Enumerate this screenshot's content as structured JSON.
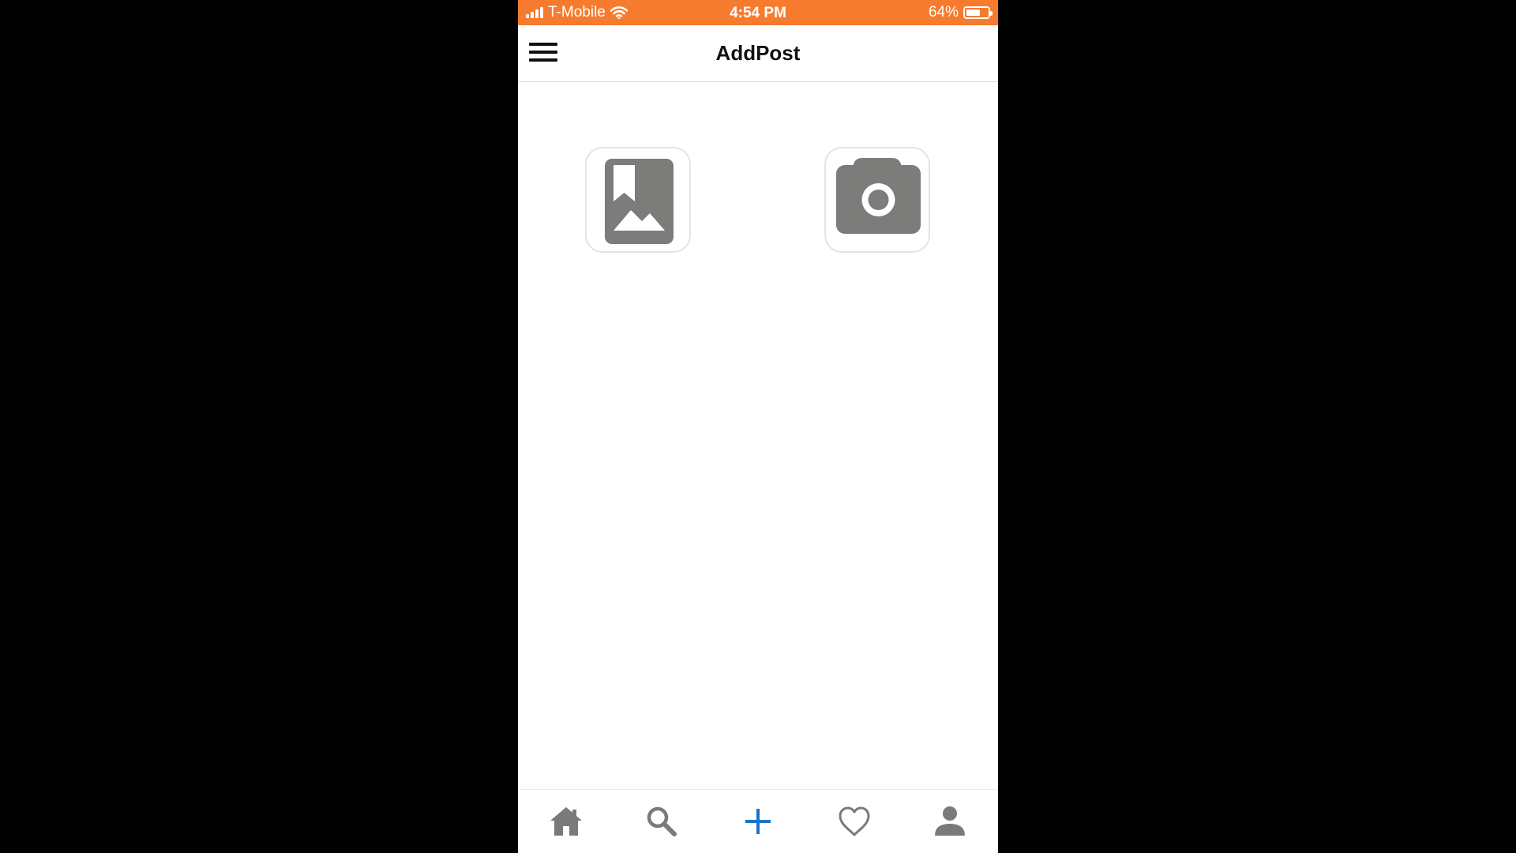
{
  "status_bar": {
    "carrier": "T-Mobile",
    "time": "4:54 PM",
    "battery_percent": "64%",
    "battery_level": 0.64,
    "background_color": "#f77b2e"
  },
  "header": {
    "title": "AddPost",
    "menu_icon": "hamburger-menu-icon"
  },
  "options": [
    {
      "icon": "photo-library-icon"
    },
    {
      "icon": "camera-icon"
    }
  ],
  "tab_bar": {
    "items": [
      {
        "icon": "home-icon",
        "active": false
      },
      {
        "icon": "search-icon",
        "active": false
      },
      {
        "icon": "add-icon",
        "active": true
      },
      {
        "icon": "heart-icon",
        "active": false
      },
      {
        "icon": "profile-icon",
        "active": false
      }
    ],
    "active_color": "#1a73c8",
    "inactive_color": "#7a7a7a"
  },
  "colors": {
    "icon_gray": "#7c7c7a",
    "accent_blue": "#1a73c8"
  }
}
